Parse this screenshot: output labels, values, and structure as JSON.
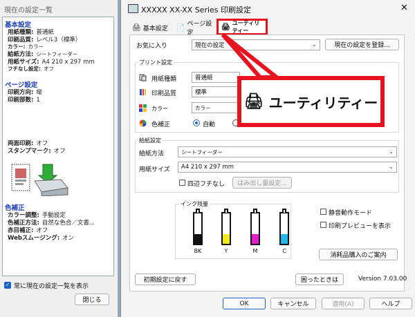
{
  "left_window": {
    "title": "現在の設定一覧",
    "sections": [
      {
        "header": "基本設定",
        "rows": [
          {
            "label": "用紙種類:",
            "value": "普通紙"
          },
          {
            "label": "印刷品質:",
            "value": "レベル3（標準）"
          },
          {
            "label": "カラー:",
            "value": "カラー"
          },
          {
            "label": "給紙方法:",
            "value": "シートフィーダー"
          },
          {
            "label": "用紙サイズ:",
            "value": "A4 210 x 297 mm"
          },
          {
            "label": "フチなし設定:",
            "value": "オフ"
          }
        ]
      },
      {
        "header": "ページ設定",
        "rows": [
          {
            "label": "印刷方向:",
            "value": "縦"
          },
          {
            "label": "印刷部数:",
            "value": "1"
          }
        ]
      },
      {
        "header": "",
        "rows": [
          {
            "label": "両面印刷:",
            "value": "オフ"
          },
          {
            "label": "スタンプマーク:",
            "value": "オフ"
          }
        ]
      },
      {
        "header": "色補正",
        "rows": [
          {
            "label": "カラー調整:",
            "value": "手動設定"
          },
          {
            "label": "色補正方法:",
            "value": "自然な色合／文書..."
          },
          {
            "label": "赤目補正:",
            "value": "オフ"
          },
          {
            "label": "Webスムージング:",
            "value": "オン"
          }
        ]
      }
    ],
    "always_show_label": "常に現在の設定一覧を表示",
    "always_show_checked": true,
    "close_label": "閉じる"
  },
  "main": {
    "title": "XXXXX XX-XX Series 印刷設定",
    "close_glyph": "✕",
    "tabs": [
      {
        "label": "基本設定"
      },
      {
        "label": "ページ設定"
      },
      {
        "label": "ユーティリティー"
      }
    ],
    "favorites": {
      "label": "お気に入り",
      "value": "現在の設定",
      "register_label": "現在の設定を登録..."
    },
    "print_settings": {
      "title": "プリント設定",
      "paper_type": {
        "label": "用紙種類",
        "value": "普通紙"
      },
      "quality": {
        "label": "印刷品質",
        "value": "標準"
      },
      "color": {
        "label": "カラー",
        "value": "カラー"
      },
      "color_correction": {
        "label": "色補正",
        "auto_label": "自動",
        "auto_selected": true
      }
    },
    "feed_settings": {
      "title": "給紙設定",
      "source": {
        "label": "給紙方法",
        "value": "シートフィーダー"
      },
      "size": {
        "label": "用紙サイズ",
        "value": "A4 210 x 297 mm"
      },
      "borderless": {
        "label": "四辺フチなし",
        "checked": false
      },
      "overflow_label": "はみ出し量設定..."
    },
    "ink": {
      "title": "インク残量",
      "tanks": [
        {
          "name": "BK",
          "color": "#111111"
        },
        {
          "name": "Y",
          "color": "#f2ea1a"
        },
        {
          "name": "M",
          "color": "#e020c9"
        },
        {
          "name": "C",
          "color": "#25b7e8"
        }
      ]
    },
    "quiet_mode": {
      "label": "静音動作モード",
      "checked": false
    },
    "preview": {
      "label": "印刷プレビューを表示",
      "checked": false
    },
    "supplies_label": "消耗品購入のご案内",
    "reset_label": "初期設定に戻す",
    "help_trouble_label": "困ったときは",
    "version": "Version 7.03.00",
    "buttons": {
      "ok": "OK",
      "cancel": "キャンセル",
      "apply": "適用(A)",
      "help": "ヘルプ"
    }
  },
  "callout": {
    "label": "ユーティリティー"
  },
  "colors": {
    "highlight": "#e8131f",
    "section_header": "#1d3fbf"
  }
}
